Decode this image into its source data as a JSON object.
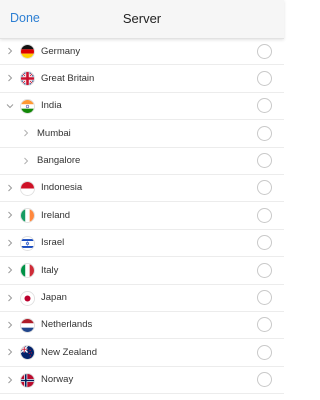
{
  "header": {
    "done_label": "Done",
    "title": "Server"
  },
  "countries": [
    {
      "name": "Germany",
      "flag": "germany-flag-icon",
      "expanded": false
    },
    {
      "name": "Great Britain",
      "flag": "uk-flag-icon",
      "expanded": false
    },
    {
      "name": "India",
      "flag": "india-flag-icon",
      "expanded": true
    },
    {
      "name": "Mumbai",
      "sub": true
    },
    {
      "name": "Bangalore",
      "sub": true
    },
    {
      "name": "Indonesia",
      "flag": "indonesia-flag-icon",
      "expanded": false
    },
    {
      "name": "Ireland",
      "flag": "ireland-flag-icon",
      "expanded": false
    },
    {
      "name": "Israel",
      "flag": "israel-flag-icon",
      "expanded": false
    },
    {
      "name": "Italy",
      "flag": "italy-flag-icon",
      "expanded": false
    },
    {
      "name": "Japan",
      "flag": "japan-flag-icon",
      "expanded": false
    },
    {
      "name": "Netherlands",
      "flag": "netherlands-flag-icon",
      "expanded": false
    },
    {
      "name": "New Zealand",
      "flag": "new-zealand-flag-icon",
      "expanded": false
    },
    {
      "name": "Norway",
      "flag": "norway-flag-icon",
      "expanded": false
    }
  ],
  "colors": {
    "accent": "#2d7fd3",
    "header_bg": "#f6f6f6"
  }
}
